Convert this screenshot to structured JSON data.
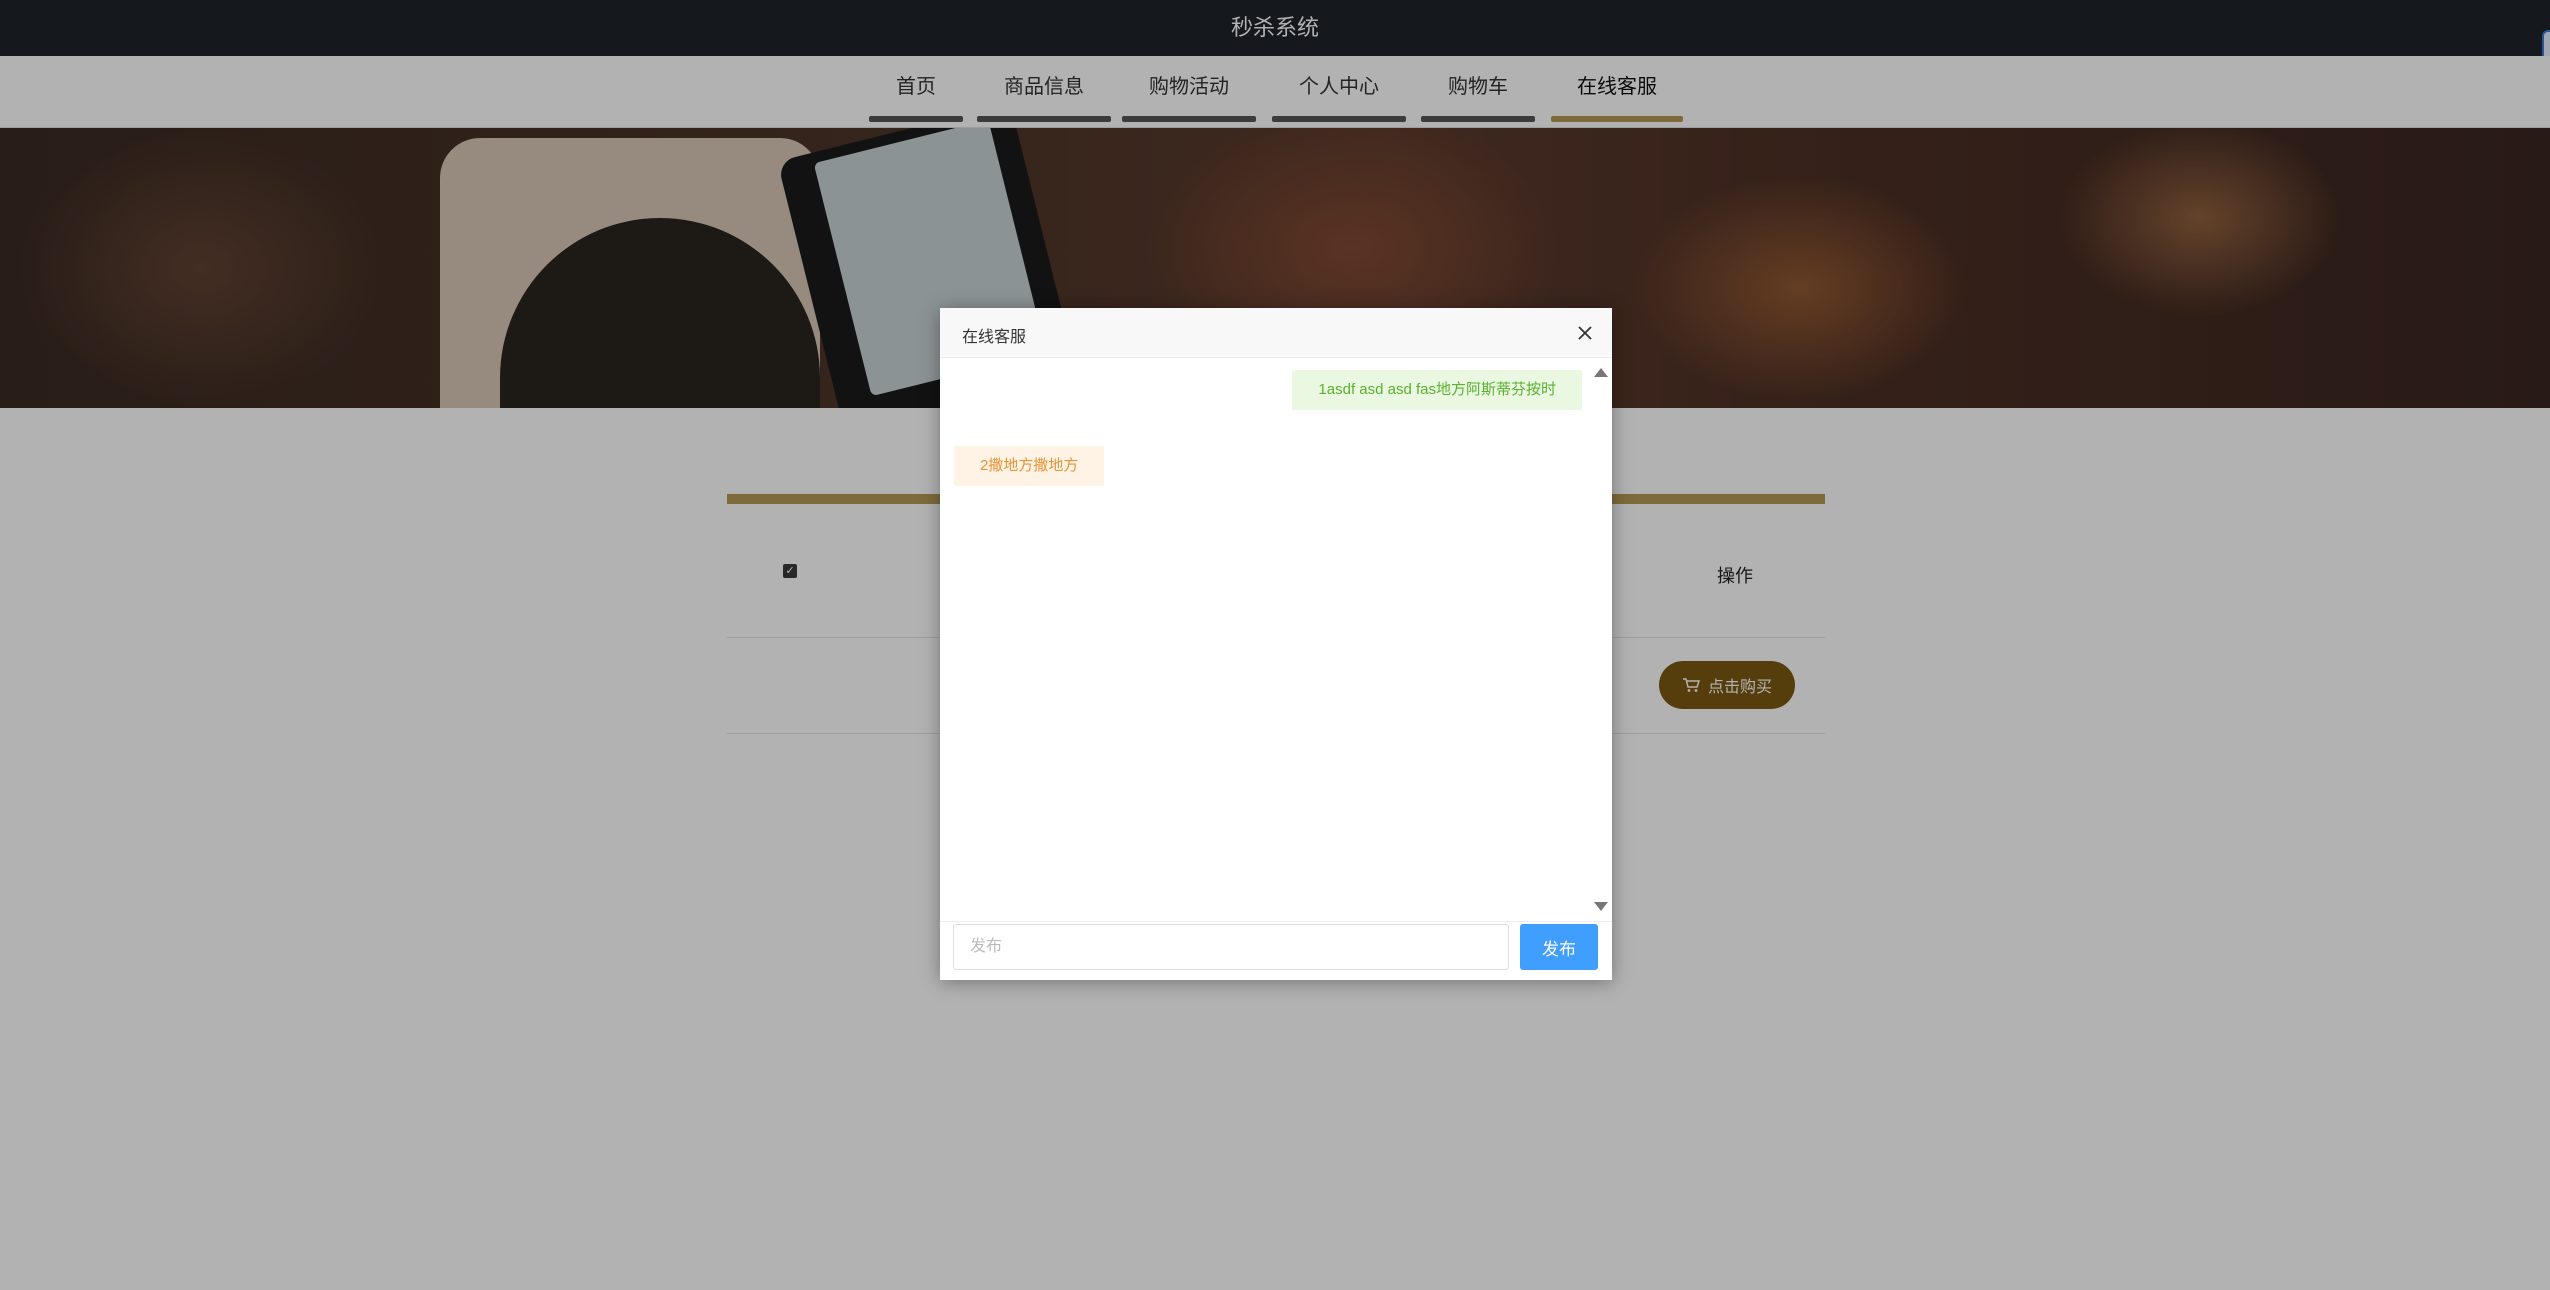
{
  "app": {
    "title": "秒杀系统"
  },
  "nav": {
    "items": [
      {
        "label": "首页"
      },
      {
        "label": "商品信息"
      },
      {
        "label": "购物活动"
      },
      {
        "label": "个人中心"
      },
      {
        "label": "购物车"
      },
      {
        "label": "在线客服"
      }
    ],
    "active": "在线客服"
  },
  "table": {
    "header": {
      "ops_label": "操作",
      "select_all_checked": true
    },
    "rows": [
      {
        "price_visible": "0",
        "buy_label": "点击购买"
      }
    ]
  },
  "dialog": {
    "title": "在线客服",
    "messages": [
      {
        "side": "right",
        "text": "1asdf asd asd fas地方阿斯蒂芬按时"
      },
      {
        "side": "left",
        "text": "2撒地方撒地方"
      }
    ],
    "input": {
      "placeholder": "发布",
      "value": ""
    },
    "send_label": "发布"
  },
  "colors": {
    "accent_gold": "#b49a55",
    "buy_button": "#7a5a10",
    "send_button": "#409eff",
    "topbar": "#1f2329"
  }
}
